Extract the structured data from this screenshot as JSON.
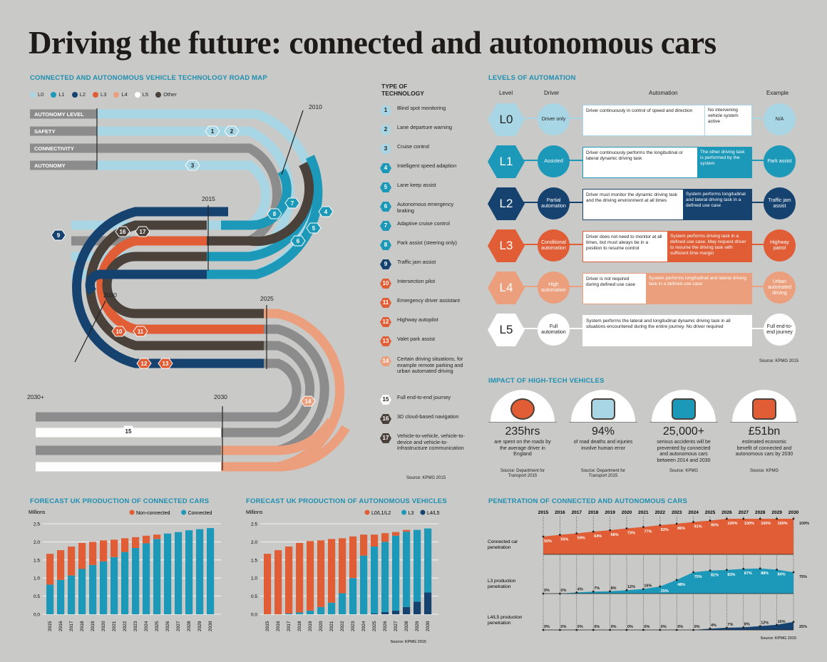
{
  "title": "Driving the future: connected and autonomous cars",
  "roadmap": {
    "heading": "CONNECTED AND AUTONOMOUS VEHICLE TECHNOLOGY ROAD MAP",
    "legend": [
      {
        "label": "L0",
        "color": "#a9d6e4"
      },
      {
        "label": "L1",
        "color": "#1c98b9"
      },
      {
        "label": "L2",
        "color": "#16426f"
      },
      {
        "label": "L3",
        "color": "#e05d35"
      },
      {
        "label": "L4",
        "color": "#ec9f7c"
      },
      {
        "label": "L5",
        "color": "#ffffff"
      },
      {
        "label": "Other",
        "color": "#4a413b"
      }
    ],
    "tracks": [
      "AUTONOMY LEVEL",
      "SAFETY",
      "CONNECTIVITY",
      "AUTONOMY"
    ],
    "years": [
      "2010",
      "2015",
      "2020",
      "2025",
      "2030+",
      "2030"
    ],
    "source": "Source: KPMG 2015"
  },
  "tech_heading": "TYPE OF TECHNOLOGY",
  "tech": [
    {
      "n": "1",
      "text": "Blind spot monitoring",
      "color": "#a9d6e4",
      "tc": "#222"
    },
    {
      "n": "2",
      "text": "Lane departure warning",
      "color": "#a9d6e4",
      "tc": "#222"
    },
    {
      "n": "3",
      "text": "Cruise control",
      "color": "#a9d6e4",
      "tc": "#222"
    },
    {
      "n": "4",
      "text": "Intelligent speed adaption",
      "color": "#1c98b9",
      "tc": "#fff"
    },
    {
      "n": "5",
      "text": "Lane keep assist",
      "color": "#1c98b9",
      "tc": "#fff"
    },
    {
      "n": "6",
      "text": "Autonomous emergency braking",
      "color": "#1c98b9",
      "tc": "#fff"
    },
    {
      "n": "7",
      "text": "Adaptive cruise control",
      "color": "#1c98b9",
      "tc": "#fff"
    },
    {
      "n": "8",
      "text": "Park assist (steering only)",
      "color": "#1c98b9",
      "tc": "#fff"
    },
    {
      "n": "9",
      "text": "Traffic jam assist",
      "color": "#16426f",
      "tc": "#fff"
    },
    {
      "n": "10",
      "text": "Intersection pilot",
      "color": "#e05d35",
      "tc": "#fff"
    },
    {
      "n": "11",
      "text": "Emergency driver assistant",
      "color": "#e05d35",
      "tc": "#fff"
    },
    {
      "n": "12",
      "text": "Highway autopilot",
      "color": "#e05d35",
      "tc": "#fff"
    },
    {
      "n": "13",
      "text": "Valet park assist",
      "color": "#e05d35",
      "tc": "#fff"
    },
    {
      "n": "14",
      "text": "Certain driving situations, for example remote parking and urban automated driving",
      "color": "#ec9f7c",
      "tc": "#fff"
    },
    {
      "n": "15",
      "text": "Full end-to-end journey",
      "color": "#ffffff",
      "tc": "#222"
    },
    {
      "n": "16",
      "text": "3D cloud-based navigation",
      "color": "#4a413b",
      "tc": "#fff"
    },
    {
      "n": "17",
      "text": "Vehicle-to-vehicle, vehicle-to-device and vehicle-to-infrastructure communication",
      "color": "#4a413b",
      "tc": "#fff"
    }
  ],
  "levels": {
    "heading": "LEVELS OF AUTOMATION",
    "headers": [
      "Level",
      "Driver",
      "Automation",
      "Example"
    ],
    "rows": [
      {
        "level": "L0",
        "driver": "Driver only",
        "a": "Driver continuously in control of speed and direction",
        "b": "No intervening vehicle system active",
        "example": "N/A",
        "color": "#a9d6e4",
        "text": "#222"
      },
      {
        "level": "L1",
        "driver": "Assisted",
        "a": "Driver continuously performs the longitudinal or lateral dynamic driving task",
        "b": "The other driving task is performed by the system",
        "example": "Park assist",
        "color": "#1c98b9",
        "text": "#fff"
      },
      {
        "level": "L2",
        "driver": "Partial automation",
        "a": "Driver must monitor the dynamic driving task and the driving environment at all times",
        "b": "System performs longitudinal and lateral driving task in a defined use case",
        "example": "Traffic jam assist",
        "color": "#16426f",
        "text": "#fff"
      },
      {
        "level": "L3",
        "driver": "Conditional automation",
        "a": "Driver does not need to monitor at all times, but must always be in a position to resume control",
        "b": "System performs driving task in a defined use case. May request driver to resume the driving task with sufficient time margin",
        "example": "Highway patrol",
        "color": "#e05d35",
        "text": "#fff"
      },
      {
        "level": "L4",
        "driver": "High automation",
        "a": "Driver is not required during defined use case",
        "b": "System performs longitudinal and lateral driving task in a defined use case",
        "example": "Urban automated driving",
        "color": "#ec9f7c",
        "text": "#fff"
      },
      {
        "level": "L5",
        "driver": "Full automation",
        "a": "System performs the lateral and longitudinal dynamic driving task in all situations encountered during the entire journey. No driver required",
        "b": "",
        "example": "Full end-to-end journey",
        "color": "#ffffff",
        "text": "#222"
      }
    ],
    "source": "Source: KPMG 2015"
  },
  "impact": {
    "heading": "IMPACT OF HIGH-TECH VEHICLES",
    "stats": [
      {
        "num": "235hrs",
        "text": "are spent on the roads by the average driver in England",
        "src": "Source: Department for Transport 2015",
        "icon": "stopwatch-icon"
      },
      {
        "num": "94%",
        "text": "of road deaths and injuries involve human error",
        "src": "Source: Department for Transport 2015",
        "icon": "robot-hand-icon"
      },
      {
        "num": "25,000+",
        "text": "serious accidents will be prevented by connected and autonomous cars between 2014 and 2030",
        "src": "Source: KPMG",
        "icon": "car-cone-icon"
      },
      {
        "num": "£51bn",
        "text": "estimated economic benefit of connected and autonomous cars by 2030",
        "src": "Source: KPMG",
        "icon": "connected-car-icon"
      }
    ]
  },
  "chart_data": [
    {
      "type": "bar",
      "title": "FORECAST UK PRODUCTION OF CONNECTED CARS",
      "ylabel": "Millions",
      "ylim": [
        0,
        2.5
      ],
      "yticks": [
        "0.0",
        "0.5",
        "1.0",
        "1.5",
        "2.0",
        "2.5"
      ],
      "categories": [
        "2015",
        "2016",
        "2017",
        "2018",
        "2019",
        "2020",
        "2021",
        "2022",
        "2023",
        "2024",
        "2025",
        "2026",
        "2027",
        "2028",
        "2029",
        "2030"
      ],
      "series": [
        {
          "name": "Connected",
          "color": "#1c98b9",
          "values": [
            0.82,
            0.95,
            1.07,
            1.25,
            1.36,
            1.46,
            1.58,
            1.72,
            1.83,
            1.96,
            2.08,
            2.23,
            2.27,
            2.32,
            2.35,
            2.38
          ]
        },
        {
          "name": "Non-connected",
          "color": "#e05d35",
          "values": [
            0.85,
            0.82,
            0.8,
            0.72,
            0.64,
            0.58,
            0.48,
            0.38,
            0.3,
            0.21,
            0.12,
            0,
            0,
            0,
            0,
            0
          ]
        }
      ],
      "legend": [
        "Non-connected",
        "Connected"
      ]
    },
    {
      "type": "bar",
      "title": "FORECAST UK PRODUCTION OF AUTONOMOUS VEHICLES",
      "ylabel": "Millions",
      "ylim": [
        0,
        2.5
      ],
      "source": "Source: KPMG 2015",
      "yticks": [
        "0.0",
        "0.5",
        "1.0",
        "1.5",
        "2.0",
        "2.5"
      ],
      "categories": [
        "2015",
        "2016",
        "2017",
        "2018",
        "2019",
        "2020",
        "2021",
        "2022",
        "2023",
        "2024",
        "2025",
        "2026",
        "2027",
        "2028",
        "2029",
        "2030"
      ],
      "series": [
        {
          "name": "L4/L5",
          "color": "#16426f",
          "values": [
            0,
            0,
            0,
            0,
            0,
            0,
            0,
            0,
            0,
            0,
            0.02,
            0.06,
            0.1,
            0.2,
            0.35,
            0.6
          ]
        },
        {
          "name": "L3",
          "color": "#1c98b9",
          "values": [
            0,
            0,
            0.02,
            0.05,
            0.1,
            0.2,
            0.32,
            0.58,
            1.0,
            1.62,
            1.85,
            1.94,
            2.07,
            2.08,
            1.98,
            1.77
          ]
        },
        {
          "name": "L0/L1/L2",
          "color": "#e05d35",
          "values": [
            1.67,
            1.77,
            1.85,
            1.92,
            1.92,
            1.84,
            1.76,
            1.52,
            1.15,
            0.58,
            0.33,
            0.24,
            0.1,
            0.05,
            0,
            0
          ]
        }
      ],
      "legend": [
        "L0/L1/L2",
        "L3",
        "L4/L5"
      ]
    },
    {
      "type": "area",
      "title": "PENETRATION OF CONNECTED AND AUTONOMOUS CARS",
      "source": "Source: KPMG 2015",
      "x": [
        "2015",
        "2016",
        "2017",
        "2018",
        "2019",
        "2020",
        "2021",
        "2022",
        "2023",
        "2024",
        "2025",
        "2026",
        "2027",
        "2028",
        "2029",
        "2030"
      ],
      "series": [
        {
          "name": "Connected car penetration",
          "color": "#e05d35",
          "values": [
            50,
            55,
            59,
            64,
            68,
            73,
            77,
            82,
            86,
            91,
            95,
            100,
            100,
            100,
            100,
            100
          ],
          "labels": [
            "50%",
            "55%",
            "59%",
            "64%",
            "68%",
            "73%",
            "77%",
            "82%",
            "86%",
            "91%",
            "95%",
            "100%",
            "100%",
            "100%",
            "100%",
            "100%"
          ]
        },
        {
          "name": "L3 production penetration",
          "color": "#1c98b9",
          "values": [
            0,
            0,
            4,
            7,
            8,
            12,
            16,
            25,
            48,
            75,
            81,
            83,
            87,
            88,
            84,
            75
          ],
          "labels": [
            "0%",
            "0%",
            "4%",
            "7%",
            "8%",
            "12%",
            "16%",
            "25%",
            "48%",
            "75%",
            "81%",
            "83%",
            "87%",
            "88%",
            "84%",
            "75%"
          ]
        },
        {
          "name": "L4/L5 production penetration",
          "color": "#16426f",
          "values": [
            0,
            0,
            0,
            0,
            0,
            0,
            0,
            0,
            0,
            0,
            4,
            7,
            8,
            12,
            16,
            25
          ],
          "labels": [
            "0%",
            "0%",
            "0%",
            "0%",
            "0%",
            "0%",
            "0%",
            "0%",
            "0%",
            "0%",
            "4%",
            "7%",
            "8%",
            "12%",
            "16%",
            "25%"
          ]
        }
      ]
    }
  ],
  "rowlabels": [
    "Connected car penetration",
    "L3 production penetration",
    "L4/L5 production penetration"
  ]
}
